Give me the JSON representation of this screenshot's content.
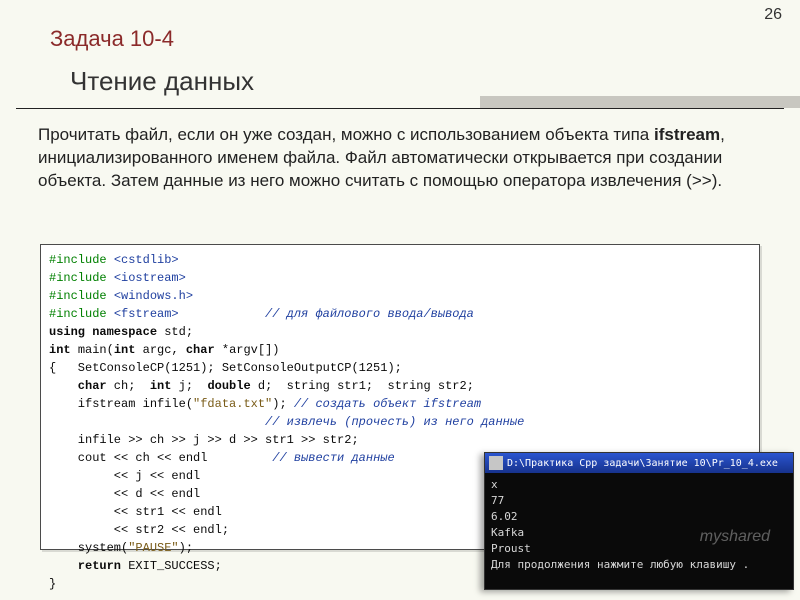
{
  "page_number": "26",
  "task_label": "Задача 10-4",
  "title": "Чтение данных",
  "body": {
    "t1": "Прочитать файл, если он уже создан, можно с использованием объекта типа ",
    "kw": "ifstream",
    "t2": ", инициализированного именем файла. Файл автоматически открывается при создании объекта. Затем данные из него можно считать с помощью оператора извлечения (>>)."
  },
  "code": {
    "l01a": "#include ",
    "l01b": "<cstdlib>",
    "l02a": "#include ",
    "l02b": "<iostream>",
    "l03a": "#include ",
    "l03b": "<windows.h>",
    "l04a": "#include ",
    "l04b": "<fstream>",
    "l04c": "            // для файлового ввода/вывода",
    "l05a": "using namespace",
    "l05b": " std;",
    "l06a": "int ",
    "l06b": "main(",
    "l06c": "int ",
    "l06d": "argc, ",
    "l06e": "char ",
    "l06f": "*argv[])",
    "l07": "{   SetConsoleCP(1251); SetConsoleOutputCP(1251);",
    "l08a": "    char",
    "l08b": " ch;  ",
    "l08c": "int",
    "l08d": " j;  ",
    "l08e": "double",
    "l08f": " d;  string str1;  string str2;",
    "l09a": "    ifstream infile(",
    "l09b": "\"fdata.txt\"",
    "l09c": "); ",
    "l09d": "// создать объект ifstream",
    "l10": "                              // извлечь (прочесть) из него данные",
    "l11": "    infile >> ch >> j >> d >> str1 >> str2;",
    "l12a": "    cout << ch << endl",
    "l12b": "         // вывести данные",
    "l13": "         << j << endl",
    "l14": "         << d << endl",
    "l15": "         << str1 << endl",
    "l16": "         << str2 << endl;",
    "l17a": "    system(",
    "l17b": "\"PAUSE\"",
    "l17c": ");",
    "l18a": "    return",
    "l18b": " EXIT_SUCCESS;",
    "l19": "}"
  },
  "console": {
    "title": "D:\\Практика Cpp задачи\\Занятие 10\\Pr_10_4.exe",
    "l1": "x",
    "l2": "77",
    "l3": "6.02",
    "l4": "Kafka",
    "l5": "Proust",
    "l6": "Для продолжения нажмите любую клавишу ."
  },
  "watermark": "myshared"
}
